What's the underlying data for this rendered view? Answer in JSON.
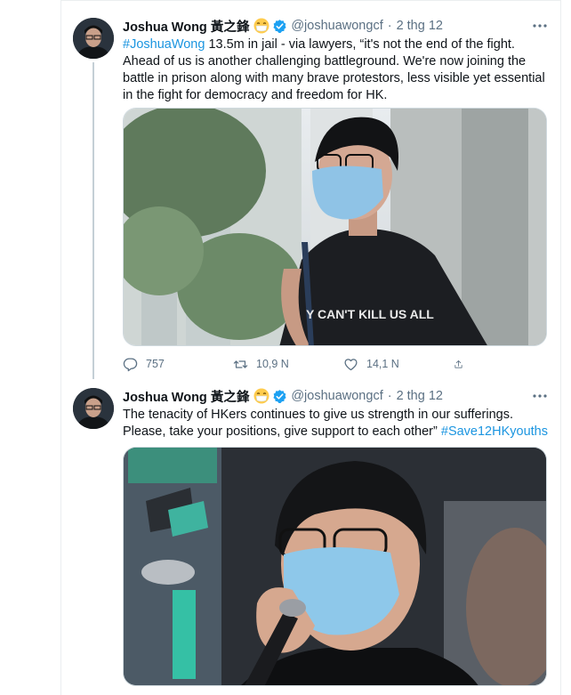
{
  "tweets": [
    {
      "author_name": "Joshua Wong 黃之鋒",
      "handle": "@joshuawongcf",
      "separator": "·",
      "time": "2 thg 12",
      "hashtag": "#JoshuaWong",
      "text": " 13.5m in jail - via lawyers, “it's not the end of the fight. Ahead of us is another challenging battleground. We're now joining the battle in prison along with many brave protestors, less visible yet essential in the fight for democracy and freedom for HK.",
      "media_shirt_text": "Y CAN'T KILL US ALL",
      "actions": {
        "replies": "757",
        "retweets": "10,9 N",
        "likes": "14,1 N"
      }
    },
    {
      "author_name": "Joshua Wong 黃之鋒",
      "handle": "@joshuawongcf",
      "separator": "·",
      "time": "2 thg 12",
      "text": "The tenacity of HKers continues to give us strength in our sufferings. Please, take your positions, give support to each other” ",
      "hashtag": "#Save12HKyouths"
    }
  ],
  "icons": {
    "emoji": "face-with-medical-mask-icon",
    "verified": "verified-badge-icon",
    "more": "more-icon",
    "reply": "reply-icon",
    "retweet": "retweet-icon",
    "like": "heart-icon",
    "share": "share-icon"
  },
  "colors": {
    "link": "#1b95e0",
    "secondary_text": "#5b7083",
    "verified": "#1da1f2"
  }
}
